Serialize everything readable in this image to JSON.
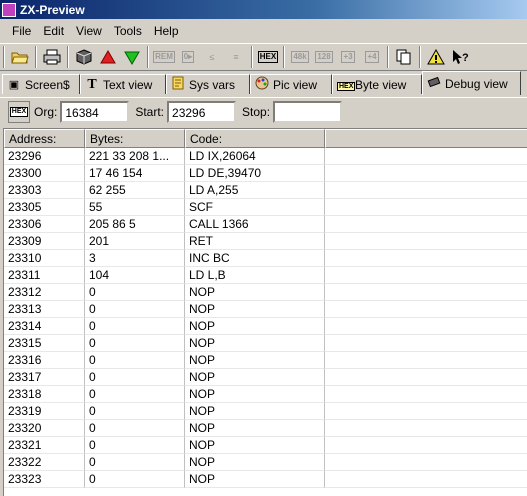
{
  "window": {
    "title": "ZX-Preview"
  },
  "menu": [
    "File",
    "Edit",
    "View",
    "Tools",
    "Help"
  ],
  "toolbar": {
    "disabled_labels": [
      "REM",
      "0▸",
      "≤",
      "≡"
    ],
    "hex_label": "HEX",
    "mode_labels": [
      "48k",
      "128",
      "+3",
      "+4"
    ]
  },
  "tabs": [
    {
      "label": "Screen$",
      "icon": "screen-icon"
    },
    {
      "label": "Text view",
      "icon": "text-T-icon"
    },
    {
      "label": "Sys vars",
      "icon": "sysvars-icon"
    },
    {
      "label": "Pic view",
      "icon": "palette-icon"
    },
    {
      "label": "Byte view",
      "icon": "hex-icon"
    },
    {
      "label": "Debug view",
      "icon": "chip-icon",
      "active": true
    }
  ],
  "debug": {
    "hex_button": "HEX",
    "org_label": "Org:",
    "org_value": "16384",
    "start_label": "Start:",
    "start_value": "23296",
    "stop_label": "Stop:",
    "stop_value": ""
  },
  "table": {
    "headers": [
      "Address:",
      "Bytes:",
      "Code:"
    ],
    "rows": [
      [
        "23296",
        "221 33 208 1...",
        "LD IX,26064"
      ],
      [
        "23300",
        "17 46 154",
        "LD DE,39470"
      ],
      [
        "23303",
        "62 255",
        "LD A,255"
      ],
      [
        "23305",
        "55",
        "SCF"
      ],
      [
        "23306",
        "205 86 5",
        "CALL 1366"
      ],
      [
        "23309",
        "201",
        "RET"
      ],
      [
        "23310",
        "3",
        "INC BC"
      ],
      [
        "23311",
        "104",
        "LD L,B"
      ],
      [
        "23312",
        "0",
        "NOP"
      ],
      [
        "23313",
        "0",
        "NOP"
      ],
      [
        "23314",
        "0",
        "NOP"
      ],
      [
        "23315",
        "0",
        "NOP"
      ],
      [
        "23316",
        "0",
        "NOP"
      ],
      [
        "23317",
        "0",
        "NOP"
      ],
      [
        "23318",
        "0",
        "NOP"
      ],
      [
        "23319",
        "0",
        "NOP"
      ],
      [
        "23320",
        "0",
        "NOP"
      ],
      [
        "23321",
        "0",
        "NOP"
      ],
      [
        "23322",
        "0",
        "NOP"
      ],
      [
        "23323",
        "0",
        "NOP"
      ]
    ]
  }
}
